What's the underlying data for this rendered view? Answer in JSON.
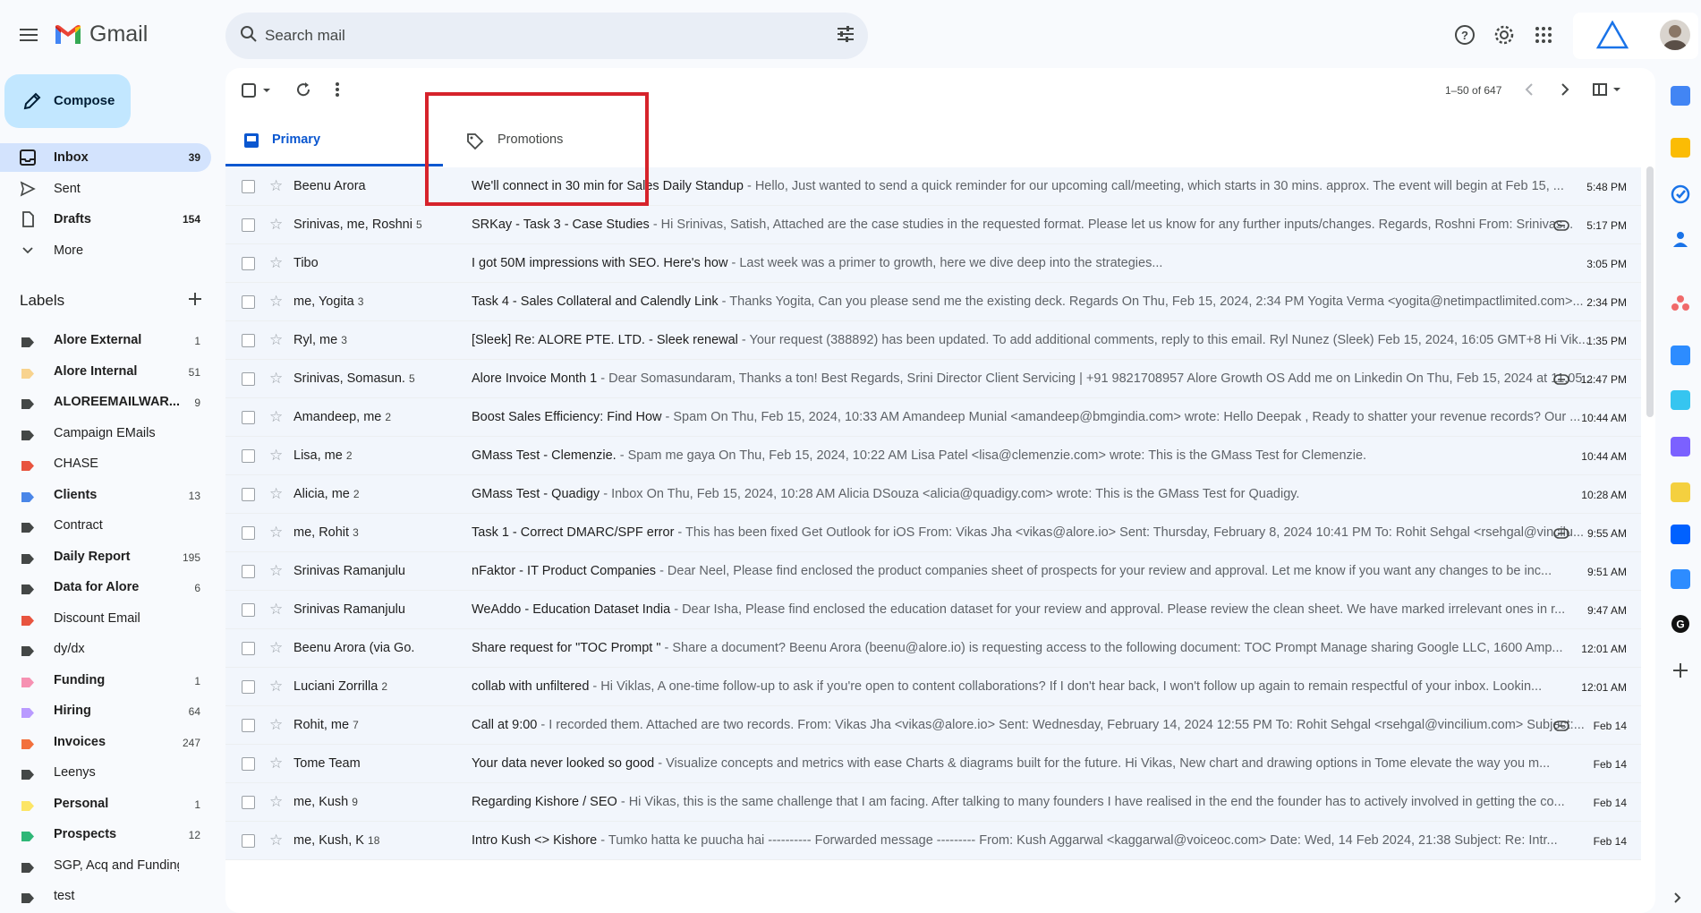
{
  "header": {
    "brand": "Gmail",
    "search_placeholder": "Search mail"
  },
  "compose": {
    "label": "Compose"
  },
  "nav": [
    {
      "label": "Inbox",
      "count": "39",
      "icon": "inbox-icon",
      "active": true,
      "bold": true
    },
    {
      "label": "Sent",
      "count": "",
      "icon": "send-icon",
      "active": false,
      "bold": false
    },
    {
      "label": "Drafts",
      "count": "154",
      "icon": "draft-icon",
      "active": false,
      "bold": true
    },
    {
      "label": "More",
      "count": "",
      "icon": "chevron-down-icon",
      "active": false,
      "bold": false
    }
  ],
  "labels": {
    "heading": "Labels",
    "items": [
      {
        "name": "Alore External",
        "count": "1",
        "color": "#444746",
        "bold": true
      },
      {
        "name": "Alore Internal",
        "count": "51",
        "color": "#f8d38e",
        "bold": true
      },
      {
        "name": "ALOREEMAILWAR...",
        "count": "9",
        "color": "#444746",
        "bold": true
      },
      {
        "name": "Campaign EMails",
        "count": "",
        "color": "#444746",
        "bold": false
      },
      {
        "name": "CHASE",
        "count": "",
        "color": "#e8543f",
        "bold": false
      },
      {
        "name": "Clients",
        "count": "13",
        "color": "#4a86e8",
        "bold": true
      },
      {
        "name": "Contract",
        "count": "",
        "color": "#444746",
        "bold": false
      },
      {
        "name": "Daily Report",
        "count": "195",
        "color": "#444746",
        "bold": true
      },
      {
        "name": "Data for Alore",
        "count": "6",
        "color": "#444746",
        "bold": true
      },
      {
        "name": "Discount Email",
        "count": "",
        "color": "#e8543f",
        "bold": false
      },
      {
        "name": "dy/dx",
        "count": "",
        "color": "#444746",
        "bold": false
      },
      {
        "name": "Funding",
        "count": "1",
        "color": "#f691b2",
        "bold": true
      },
      {
        "name": "Hiring",
        "count": "64",
        "color": "#b99aff",
        "bold": true
      },
      {
        "name": "Invoices",
        "count": "247",
        "color": "#f2703c",
        "bold": true
      },
      {
        "name": "Leenys",
        "count": "",
        "color": "#444746",
        "bold": false
      },
      {
        "name": "Personal",
        "count": "1",
        "color": "#fce566",
        "bold": true
      },
      {
        "name": "Prospects",
        "count": "12",
        "color": "#2fb777",
        "bold": true
      },
      {
        "name": "SGP, Acq and Funding",
        "count": "",
        "color": "#444746",
        "bold": false
      },
      {
        "name": "test",
        "count": "",
        "color": "#444746",
        "bold": false
      }
    ]
  },
  "toolbar": {
    "pager": "1–50 of 647"
  },
  "tabs": {
    "primary": "Primary",
    "promotions": "Promotions"
  },
  "emails": [
    {
      "sender": "Beenu Arora",
      "count": "",
      "subject": "We'll connect in 30 min for Sales Daily Standup",
      "snippet": " - Hello, Just wanted to send a quick reminder for our upcoming call/meeting, which starts in 30 mins. approx. The event will begin at Feb 15, ...",
      "time": "5:48 PM",
      "attachment": false
    },
    {
      "sender": "Srinivas, me, Roshni",
      "count": "5",
      "subject": "SRKay - Task 3 - Case Studies",
      "snippet": " - Hi Srinivas, Satish, Attached are the case studies in the requested format. Please let us know for any further inputs/changes. Regards, Roshni From: Srinivas...",
      "time": "5:17 PM",
      "attachment": true
    },
    {
      "sender": "Tibo",
      "count": "",
      "subject": "I got 50M impressions with SEO. Here's how",
      "snippet": " - Last week was a primer to growth, here we dive deep into the strategies...",
      "time": "3:05 PM",
      "attachment": false
    },
    {
      "sender": "me, Yogita",
      "count": "3",
      "subject": "Task 4 - Sales Collateral and Calendly Link",
      "snippet": " - Thanks Yogita, Can you please send me the existing deck. Regards On Thu, Feb 15, 2024, 2:34 PM Yogita Verma <yogita@netimpactlimited.com>...",
      "time": "2:34 PM",
      "attachment": false
    },
    {
      "sender": "Ryl, me",
      "count": "3",
      "subject": "[Sleek] Re: ALORE PTE. LTD. - Sleek renewal",
      "snippet": " - Your request (388892) has been updated. To add additional comments, reply to this email. Ryl Nunez (Sleek) Feb 15, 2024, 16:05 GMT+8 Hi Vik...",
      "time": "1:35 PM",
      "attachment": false
    },
    {
      "sender": "Srinivas, Somasun.",
      "count": "5",
      "subject": "Alore Invoice Month 1",
      "snippet": " - Dear Somasundaram, Thanks a ton! Best Regards, Srini Director Client Servicing | +91 9821708957 Alore Growth OS Add me on Linkedin On Thu, Feb 15, 2024 at 11:05...",
      "time": "12:47 PM",
      "attachment": true
    },
    {
      "sender": "Amandeep, me",
      "count": "2",
      "subject": "Boost Sales Efficiency: Find How",
      "snippet": " - Spam On Thu, Feb 15, 2024, 10:33 AM Amandeep Munial <amandeep@bmgindia.com> wrote: Hello Deepak , Ready to shatter your revenue records? Our ...",
      "time": "10:44 AM",
      "attachment": false
    },
    {
      "sender": "Lisa, me",
      "count": "2",
      "subject": "GMass Test - Clemenzie.",
      "snippet": " - Spam me gaya On Thu, Feb 15, 2024, 10:22 AM Lisa Patel <lisa@clemenzie.com> wrote: This is the GMass Test for Clemenzie.",
      "time": "10:44 AM",
      "attachment": false
    },
    {
      "sender": "Alicia, me",
      "count": "2",
      "subject": "GMass Test - Quadigy",
      "snippet": " - Inbox On Thu, Feb 15, 2024, 10:28 AM Alicia DSouza <alicia@quadigy.com> wrote: This is the GMass Test for Quadigy.",
      "time": "10:28 AM",
      "attachment": false
    },
    {
      "sender": "me, Rohit",
      "count": "3",
      "subject": "Task 1 - Correct DMARC/SPF error",
      "snippet": " - This has been fixed Get Outlook for iOS From: Vikas Jha <vikas@alore.io> Sent: Thursday, February 8, 2024 10:41 PM To: Rohit Sehgal <rsehgal@vincilu...",
      "time": "9:55 AM",
      "attachment": true
    },
    {
      "sender": "Srinivas Ramanjulu",
      "count": "",
      "subject": "nFaktor - IT Product Companies",
      "snippet": " - Dear Neel, Please find enclosed the product companies sheet of prospects for your review and approval. Let me know if you want any changes to be inc...",
      "time": "9:51 AM",
      "attachment": false
    },
    {
      "sender": "Srinivas Ramanjulu",
      "count": "",
      "subject": "WeAddo - Education Dataset India",
      "snippet": " - Dear Isha, Please find enclosed the education dataset for your review and approval. Please review the clean sheet. We have marked irrelevant ones in r...",
      "time": "9:47 AM",
      "attachment": false
    },
    {
      "sender": "Beenu Arora (via Go.",
      "count": "",
      "subject": "Share request for \"TOC Prompt \"",
      "snippet": " - Share a document? Beenu Arora (beenu@alore.io) is requesting access to the following document: TOC Prompt Manage sharing Google LLC, 1600 Amp...",
      "time": "12:01 AM",
      "attachment": false
    },
    {
      "sender": "Luciani Zorrilla",
      "count": "2",
      "subject": "collab with unfiltered",
      "snippet": " - Hi Viklas, A one-time follow-up to ask if you're open to content collaborations? If I don't hear back, I won't follow up again to remain respectful of your inbox. Lookin...",
      "time": "12:01 AM",
      "attachment": false
    },
    {
      "sender": "Rohit, me",
      "count": "7",
      "subject": "Call at 9:00",
      "snippet": " - I recorded them. Attached are two records. From: Vikas Jha <vikas@alore.io> Sent: Wednesday, February 14, 2024 12:55 PM To: Rohit Sehgal <rsehgal@vincilium.com> Subject:...",
      "time": "Feb 14",
      "attachment": true
    },
    {
      "sender": "Tome Team",
      "count": "",
      "subject": "Your data never looked so good",
      "snippet": " - Visualize concepts and metrics with ease    Charts & diagrams built for the future. Hi Vikas, New chart and drawing options in Tome elevate the way you m...",
      "time": "Feb 14",
      "attachment": false
    },
    {
      "sender": "me, Kush",
      "count": "9",
      "subject": "Regarding Kishore / SEO",
      "snippet": " - Hi Vikas, this is the same challenge that I am facing. After talking to many founders I have realised in the end the founder has to actively involved in getting the co...",
      "time": "Feb 14",
      "attachment": false
    },
    {
      "sender": "me, Kush, K",
      "count": "18",
      "subject": "Intro Kush <> Kishore",
      "snippet": " - Tumko hatta ke puucha hai ---------- Forwarded message --------- From: Kush Aggarwal <kaggarwal@voiceoc.com> Date: Wed, 14 Feb 2024, 21:38 Subject: Re: Intr...",
      "time": "Feb 14",
      "attachment": false
    }
  ],
  "side_panel": [
    {
      "icon": "calendar-icon",
      "color": "#4285f4"
    },
    {
      "icon": "keep-icon",
      "color": "#fbbc04"
    },
    {
      "icon": "tasks-icon",
      "color": "#1a73e8"
    },
    {
      "icon": "contacts-icon",
      "color": "#1a73e8"
    },
    {
      "icon": "asana-icon",
      "color": "#f06a6a"
    },
    {
      "icon": "zoom-icon",
      "color": "#2d8cff"
    },
    {
      "icon": "slack-icon",
      "color": "#36c5f0"
    },
    {
      "icon": "app-icon",
      "color": "#7b61ff"
    },
    {
      "icon": "download-icon",
      "color": "#f4d03f"
    },
    {
      "icon": "dropbox-icon",
      "color": "#0061ff"
    },
    {
      "icon": "zoom-icon",
      "color": "#2d8cff"
    },
    {
      "icon": "grammarly-icon",
      "color": "#15c39a"
    },
    {
      "icon": "add-icon",
      "color": "#444746"
    }
  ]
}
